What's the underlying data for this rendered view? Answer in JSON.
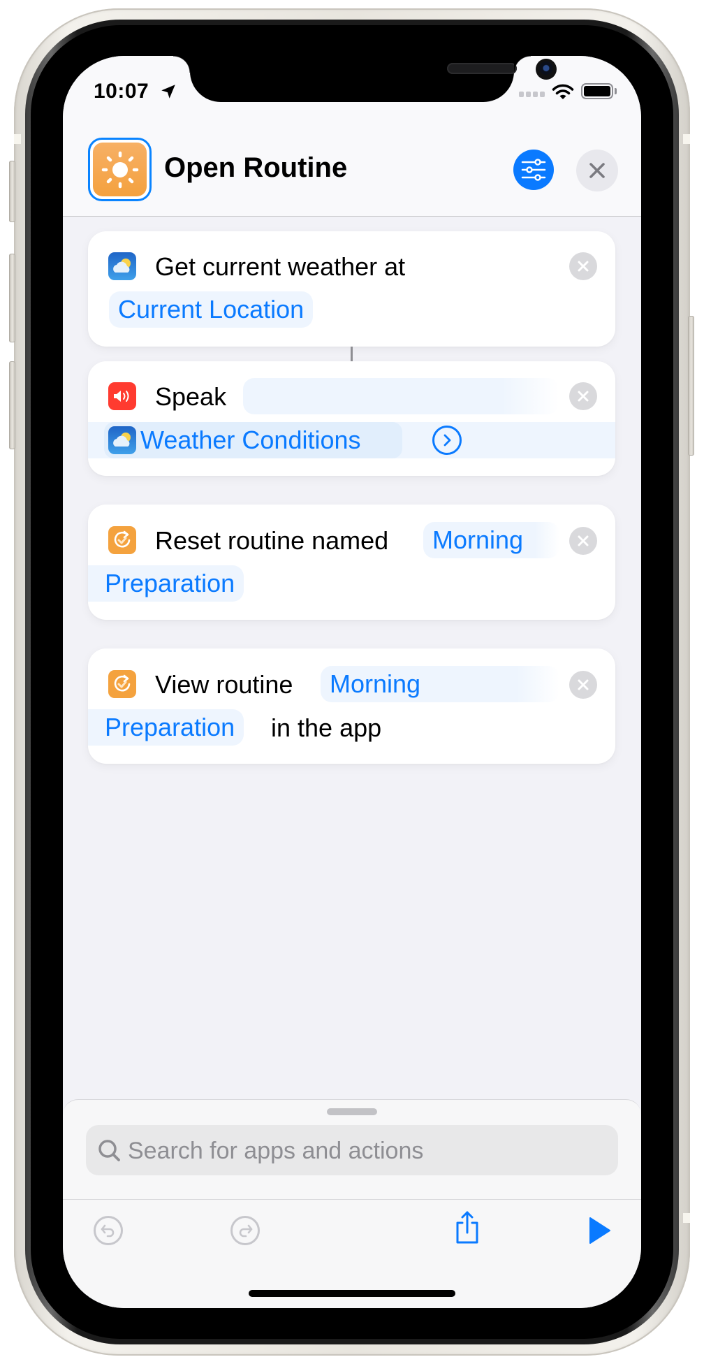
{
  "status_bar": {
    "time": "10:07",
    "location_icon": "location-arrow-icon",
    "signal_icon": "cellular-signal-icon",
    "wifi_icon": "wifi-icon",
    "battery_icon": "battery-icon",
    "battery_level": 1.0
  },
  "header": {
    "shortcut_icon": "sun-icon",
    "shortcut_color": "#F5A54A",
    "title": "Open Routine",
    "settings_icon": "sliders-icon",
    "close_icon": "close-icon"
  },
  "actions": [
    {
      "app_icon": "weather-icon",
      "text_before": "Get current weather at",
      "parameter": "Current Location",
      "clear_icon": "clear-icon"
    },
    {
      "app_icon": "speaker-icon",
      "text_before": "Speak",
      "parameter": "",
      "variable": "Weather Conditions",
      "variable_icon": "weather-icon",
      "expand_icon": "chevron-right-circle-icon",
      "clear_icon": "clear-icon"
    },
    {
      "app_icon": "routine-icon",
      "text_before": "Reset routine named",
      "parameter_line1": "Morning",
      "parameter_line2": "Preparation",
      "clear_icon": "clear-icon"
    },
    {
      "app_icon": "routine-icon",
      "text_before": "View routine",
      "parameter_line1": "Morning",
      "parameter_line2": "Preparation",
      "text_after": "in the app",
      "clear_icon": "clear-icon"
    }
  ],
  "bottom_sheet": {
    "search_placeholder": "Search for apps and actions",
    "search_icon": "search-icon"
  },
  "toolbar": {
    "undo_icon": "undo-icon",
    "redo_icon": "redo-icon",
    "share_icon": "share-icon",
    "run_icon": "play-icon"
  },
  "colors": {
    "accent": "#0A7AFF",
    "parameter_bg": "#EEF5FE",
    "speak_icon_bg": "#FF3B30",
    "routine_icon_bg": "#F4A23E",
    "disabled": "#C7C7CC"
  }
}
